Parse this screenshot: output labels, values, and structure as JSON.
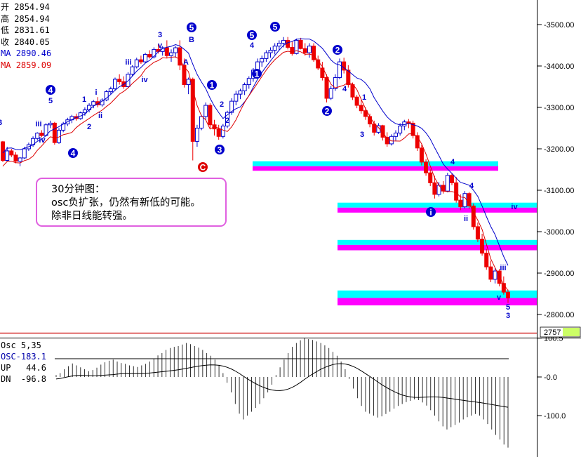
{
  "info_panel": {
    "open": {
      "label": "开",
      "value": "2854.94"
    },
    "high": {
      "label": "高",
      "value": "2854.94"
    },
    "low": {
      "label": "低",
      "value": "2831.61"
    },
    "close": {
      "label": "收",
      "value": "2840.05"
    },
    "ma1": {
      "label": "MA",
      "value": "2890.46"
    },
    "ma2": {
      "label": "MA",
      "value": "2859.09"
    }
  },
  "note": {
    "line1": "30分钟图：",
    "line2": "osc负扩张，仍然有新低的可能。",
    "line3": "除非日线能转强。"
  },
  "osc_panel": {
    "title": "Osc 5,35",
    "osc": "OSC-183.1",
    "up": "UP   44.6",
    "dn": "DN  -96.8"
  },
  "colors": {
    "up_candle": "#0000cc",
    "down_candle": "#ee0000",
    "ma_blue": "#0000cc",
    "ma_red": "#dd0000",
    "band_cyan": "#00ffff",
    "band_magenta": "#ff00ff",
    "wave_label": "#0000cc",
    "circle_blue": "#0000cc",
    "circle_red": "#dd0000"
  },
  "chart_data": [
    {
      "type": "candlestick",
      "title": "",
      "y_ticks": [
        3500,
        3400,
        3300,
        3200,
        3100,
        3000,
        2900,
        2800
      ],
      "ylim": [
        2757,
        3560
      ],
      "current_price_label": "2757",
      "candles": [
        [
          3217,
          3219,
          3168,
          3172
        ],
        [
          3172,
          3205,
          3170,
          3195
        ],
        [
          3195,
          3200,
          3180,
          3185
        ],
        [
          3185,
          3192,
          3165,
          3170
        ],
        [
          3170,
          3180,
          3158,
          3178
        ],
        [
          3178,
          3205,
          3175,
          3200
        ],
        [
          3200,
          3215,
          3195,
          3210
        ],
        [
          3210,
          3230,
          3205,
          3225
        ],
        [
          3225,
          3240,
          3220,
          3238
        ],
        [
          3238,
          3245,
          3228,
          3232
        ],
        [
          3232,
          3262,
          3230,
          3258
        ],
        [
          3258,
          3268,
          3250,
          3262
        ],
        [
          3262,
          3265,
          3210,
          3215
        ],
        [
          3215,
          3250,
          3212,
          3245
        ],
        [
          3245,
          3265,
          3240,
          3260
        ],
        [
          3260,
          3275,
          3255,
          3270
        ],
        [
          3270,
          3282,
          3262,
          3278
        ],
        [
          3278,
          3285,
          3268,
          3273
        ],
        [
          3273,
          3290,
          3270,
          3287
        ],
        [
          3287,
          3300,
          3280,
          3294
        ],
        [
          3294,
          3310,
          3288,
          3305
        ],
        [
          3305,
          3318,
          3298,
          3314
        ],
        [
          3314,
          3325,
          3300,
          3306
        ],
        [
          3306,
          3322,
          3302,
          3318
        ],
        [
          3318,
          3342,
          3315,
          3338
        ],
        [
          3338,
          3350,
          3332,
          3345
        ],
        [
          3345,
          3372,
          3340,
          3368
        ],
        [
          3368,
          3380,
          3355,
          3362
        ],
        [
          3362,
          3375,
          3345,
          3350
        ],
        [
          3350,
          3385,
          3348,
          3380
        ],
        [
          3380,
          3402,
          3376,
          3398
        ],
        [
          3398,
          3420,
          3394,
          3415
        ],
        [
          3415,
          3425,
          3405,
          3410
        ],
        [
          3410,
          3432,
          3406,
          3428
        ],
        [
          3428,
          3438,
          3418,
          3422
        ],
        [
          3422,
          3445,
          3418,
          3440
        ],
        [
          3440,
          3452,
          3430,
          3435
        ],
        [
          3435,
          3448,
          3425,
          3444
        ],
        [
          3444,
          3462,
          3420,
          3425
        ],
        [
          3425,
          3440,
          3410,
          3432
        ],
        [
          3432,
          3448,
          3420,
          3444
        ],
        [
          3444,
          3462,
          3390,
          3402
        ],
        [
          3402,
          3418,
          3348,
          3355
        ],
        [
          3355,
          3372,
          3332,
          3368
        ],
        [
          3368,
          3372,
          3172,
          3218
        ],
        [
          3218,
          3258,
          3205,
          3250
        ],
        [
          3250,
          3282,
          3245,
          3278
        ],
        [
          3278,
          3312,
          3270,
          3305
        ],
        [
          3305,
          3310,
          3250,
          3258
        ],
        [
          3258,
          3270,
          3232,
          3248
        ],
        [
          3248,
          3258,
          3222,
          3230
        ],
        [
          3230,
          3260,
          3225,
          3255
        ],
        [
          3255,
          3292,
          3250,
          3288
        ],
        [
          3288,
          3322,
          3282,
          3315
        ],
        [
          3315,
          3340,
          3305,
          3332
        ],
        [
          3332,
          3345,
          3320,
          3340
        ],
        [
          3340,
          3360,
          3330,
          3355
        ],
        [
          3355,
          3375,
          3345,
          3370
        ],
        [
          3370,
          3395,
          3362,
          3390
        ],
        [
          3390,
          3418,
          3382,
          3410
        ],
        [
          3410,
          3425,
          3398,
          3418
        ],
        [
          3418,
          3438,
          3410,
          3432
        ],
        [
          3432,
          3445,
          3420,
          3438
        ],
        [
          3438,
          3455,
          3428,
          3448
        ],
        [
          3448,
          3462,
          3438,
          3455
        ],
        [
          3455,
          3470,
          3445,
          3462
        ],
        [
          3462,
          3470,
          3440,
          3445
        ],
        [
          3445,
          3460,
          3425,
          3430
        ],
        [
          3430,
          3466,
          3428,
          3462
        ],
        [
          3462,
          3468,
          3440,
          3442
        ],
        [
          3442,
          3455,
          3425,
          3432
        ],
        [
          3432,
          3455,
          3420,
          3448
        ],
        [
          3448,
          3455,
          3410,
          3415
        ],
        [
          3415,
          3425,
          3390,
          3395
        ],
        [
          3395,
          3410,
          3365,
          3372
        ],
        [
          3372,
          3380,
          3312,
          3322
        ],
        [
          3322,
          3352,
          3318,
          3345
        ],
        [
          3345,
          3380,
          3340,
          3372
        ],
        [
          3372,
          3418,
          3368,
          3410
        ],
        [
          3410,
          3420,
          3382,
          3390
        ],
        [
          3390,
          3402,
          3348,
          3355
        ],
        [
          3355,
          3360,
          3318,
          3325
        ],
        [
          3325,
          3330,
          3298,
          3305
        ],
        [
          3305,
          3318,
          3285,
          3292
        ],
        [
          3292,
          3300,
          3270,
          3278
        ],
        [
          3278,
          3285,
          3252,
          3260
        ],
        [
          3260,
          3268,
          3232,
          3240
        ],
        [
          3240,
          3262,
          3236,
          3256
        ],
        [
          3256,
          3258,
          3220,
          3228
        ],
        [
          3228,
          3240,
          3205,
          3212
        ],
        [
          3212,
          3235,
          3208,
          3230
        ],
        [
          3230,
          3245,
          3220,
          3238
        ],
        [
          3238,
          3262,
          3232,
          3255
        ],
        [
          3255,
          3270,
          3245,
          3265
        ],
        [
          3265,
          3272,
          3250,
          3262
        ],
        [
          3262,
          3268,
          3225,
          3232
        ],
        [
          3232,
          3240,
          3195,
          3202
        ],
        [
          3202,
          3210,
          3160,
          3168
        ],
        [
          3168,
          3175,
          3135,
          3142
        ],
        [
          3142,
          3150,
          3110,
          3118
        ],
        [
          3118,
          3135,
          3080,
          3090
        ],
        [
          3090,
          3120,
          3085,
          3112
        ],
        [
          3112,
          3122,
          3092,
          3098
        ],
        [
          3098,
          3142,
          3095,
          3136
        ],
        [
          3136,
          3140,
          3112,
          3118
        ],
        [
          3118,
          3132,
          3070,
          3076
        ],
        [
          3076,
          3090,
          3052,
          3060
        ],
        [
          3060,
          3098,
          3056,
          3092
        ],
        [
          3092,
          3096,
          3055,
          3062
        ],
        [
          3062,
          3068,
          3005,
          3012
        ],
        [
          3012,
          3022,
          2975,
          2982
        ],
        [
          2982,
          2995,
          2942,
          2948
        ],
        [
          2948,
          2958,
          2908,
          2915
        ],
        [
          2915,
          2930,
          2878,
          2885
        ],
        [
          2885,
          2912,
          2875,
          2905
        ],
        [
          2905,
          2910,
          2868,
          2875
        ],
        [
          2875,
          2892,
          2848,
          2854
        ],
        [
          2854,
          2860,
          2828,
          2840
        ]
      ],
      "ma_blue_last": 2890.46,
      "ma_red_last": 2859.09,
      "bands": [
        {
          "color": "cyan",
          "y_top": 3170,
          "y_bottom": 3158
        },
        {
          "color": "magenta",
          "y_top": 3158,
          "y_bottom": 3147
        },
        {
          "color": "cyan",
          "y_top": 3070,
          "y_bottom": 3058
        },
        {
          "color": "magenta",
          "y_top": 3058,
          "y_bottom": 3046
        },
        {
          "color": "cyan",
          "y_top": 2980,
          "y_bottom": 2968
        },
        {
          "color": "magenta",
          "y_top": 2968,
          "y_bottom": 2955
        },
        {
          "color": "cyan",
          "y_top": 2858,
          "y_bottom": 2840
        },
        {
          "color": "magenta",
          "y_top": 2840,
          "y_bottom": 2822
        }
      ],
      "wave_labels": [
        "3",
        "5",
        "iii",
        "iv",
        "1",
        "2",
        "i",
        "ii",
        "4",
        "iii",
        "3",
        "v",
        "iv",
        "4",
        "5",
        "A",
        "B",
        "C",
        "1",
        "2",
        "2",
        "3",
        "5",
        "4",
        "5",
        "1",
        "2",
        "2",
        "1",
        "4",
        "3",
        "i",
        "ii",
        "4",
        "4",
        "iv",
        "iii",
        "v",
        "5",
        "3"
      ]
    },
    {
      "type": "bar",
      "title": "Osc 5,35",
      "y_ticks": [
        100.5,
        0.0,
        -100.0
      ],
      "y_tick_labels": [
        "100.5",
        "-0.0",
        "-100.0"
      ],
      "series": [
        {
          "name": "OSC",
          "last": -183.1
        },
        {
          "name": "UP",
          "last": 44.6
        },
        {
          "name": "DN",
          "last": -96.8
        }
      ],
      "osc_values": [
        5,
        10,
        20,
        28,
        35,
        30,
        25,
        20,
        15,
        18,
        24,
        32,
        38,
        42,
        45,
        40,
        36,
        34,
        30,
        28,
        26,
        30,
        34,
        40,
        48,
        56,
        62,
        70,
        75,
        78,
        80,
        84,
        88,
        85,
        80,
        76,
        70,
        62,
        55,
        45,
        30,
        10,
        -15,
        -40,
        -70,
        -95,
        -110,
        -100,
        -90,
        -80,
        -70,
        -55,
        -40,
        -20,
        5,
        25,
        45,
        62,
        78,
        88,
        95,
        100,
        98,
        96,
        92,
        88,
        82,
        75,
        65,
        55,
        40,
        20,
        -5,
        -30,
        -55,
        -75,
        -90,
        -95,
        -100,
        -105,
        -102,
        -96,
        -90,
        -82,
        -75,
        -70,
        -65,
        -62,
        -58,
        -60,
        -66,
        -74,
        -86,
        -100,
        -115,
        -128,
        -136,
        -130,
        -124,
        -118,
        -110,
        -104,
        -100,
        -96,
        -100,
        -110,
        -122,
        -136,
        -150,
        -162,
        -175,
        -183
      ]
    }
  ]
}
